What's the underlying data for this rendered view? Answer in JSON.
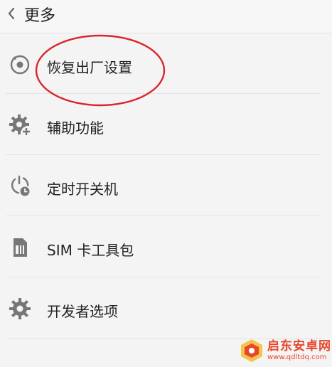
{
  "header": {
    "back_icon": "chevron-left-icon",
    "title": "更多"
  },
  "menu": {
    "items": [
      {
        "label": "恢复出厂设置",
        "icon": "factory-reset-icon"
      },
      {
        "label": "辅助功能",
        "icon": "gear-plus-icon"
      },
      {
        "label": "定时开关机",
        "icon": "power-clock-icon"
      },
      {
        "label": "SIM 卡工具包",
        "icon": "sim-card-icon"
      },
      {
        "label": "开发者选项",
        "icon": "gear-icon"
      }
    ]
  },
  "annotation": {
    "color": "#d9262b",
    "shape": "ellipse"
  },
  "watermark": {
    "name": "启东安卓网",
    "url": "www.qdltdq.com",
    "color": "#e8452a"
  }
}
